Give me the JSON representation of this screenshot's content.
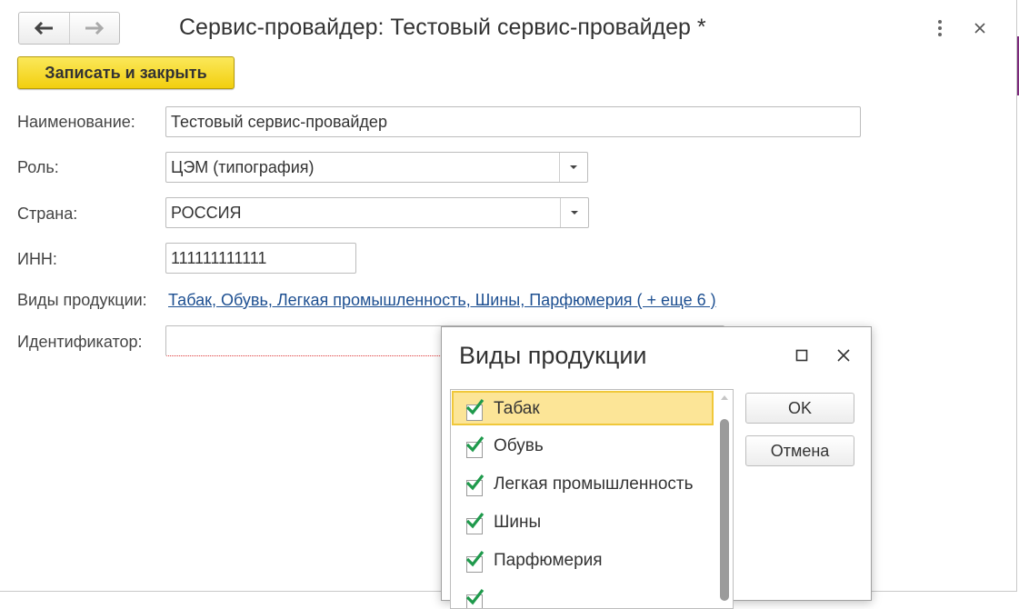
{
  "window": {
    "title": "Сервис-провайдер: Тестовый сервис-провайдер *",
    "back_icon": "arrow-left-icon",
    "forward_icon": "arrow-right-icon",
    "more_icon": "vertical-dots-icon",
    "close_icon": "close-icon"
  },
  "toolbar": {
    "save_close_label": "Записать и закрыть"
  },
  "form": {
    "name": {
      "label": "Наименование:",
      "value": "Тестовый сервис-провайдер"
    },
    "role": {
      "label": "Роль:",
      "value": "ЦЭМ (типография)"
    },
    "country": {
      "label": "Страна:",
      "value": "РОССИЯ"
    },
    "inn": {
      "label": "ИНН:",
      "value": "111111111111"
    },
    "products": {
      "label": "Виды продукции:",
      "value": "Табак, Обувь, Легкая промышленность, Шины, Парфюмерия ( + еще 6 )"
    },
    "identifier": {
      "label": "Идентификатор:",
      "value": ""
    }
  },
  "dialog": {
    "title": "Виды продукции",
    "items": [
      {
        "label": "Табак",
        "checked": true,
        "selected": true
      },
      {
        "label": "Обувь",
        "checked": true,
        "selected": false
      },
      {
        "label": "Легкая промышленность",
        "checked": true,
        "selected": false
      },
      {
        "label": "Шины",
        "checked": true,
        "selected": false
      },
      {
        "label": "Парфюмерия",
        "checked": true,
        "selected": false
      }
    ],
    "ok_label": "OK",
    "cancel_label": "Отмена"
  },
  "colors": {
    "accent_yellow": "#f5d423",
    "link": "#1d4f91",
    "check_green": "#1f9a4c",
    "selection": "#fce597"
  }
}
